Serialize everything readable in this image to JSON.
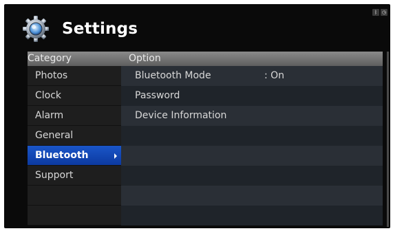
{
  "header": {
    "title": "Settings"
  },
  "status_icons": [
    "bluetooth-icon",
    "clock-icon"
  ],
  "category": {
    "header": "Category",
    "items": [
      {
        "label": "Photos"
      },
      {
        "label": "Clock"
      },
      {
        "label": "Alarm"
      },
      {
        "label": "General"
      },
      {
        "label": "Bluetooth",
        "selected": true
      },
      {
        "label": "Support"
      }
    ]
  },
  "option": {
    "header": "Option",
    "rows": [
      {
        "label": "Bluetooth Mode",
        "value": ": On"
      },
      {
        "label": "Password",
        "value": ""
      },
      {
        "label": "Device Information",
        "value": ""
      }
    ]
  }
}
